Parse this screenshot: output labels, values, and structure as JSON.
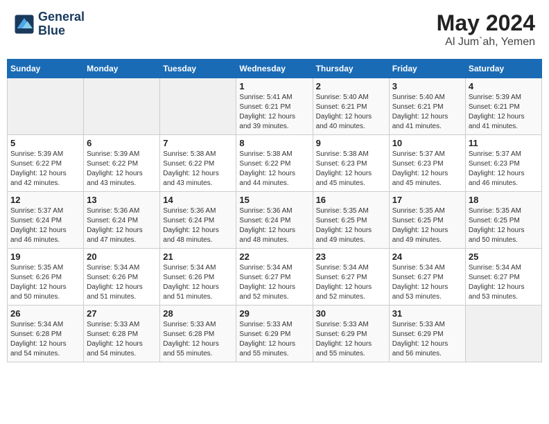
{
  "header": {
    "logo_line1": "General",
    "logo_line2": "Blue",
    "title": "May 2024",
    "subtitle": "Al Jum`ah, Yemen"
  },
  "weekdays": [
    "Sunday",
    "Monday",
    "Tuesday",
    "Wednesday",
    "Thursday",
    "Friday",
    "Saturday"
  ],
  "weeks": [
    [
      {
        "day": "",
        "info": ""
      },
      {
        "day": "",
        "info": ""
      },
      {
        "day": "",
        "info": ""
      },
      {
        "day": "1",
        "info": "Sunrise: 5:41 AM\nSunset: 6:21 PM\nDaylight: 12 hours\nand 39 minutes."
      },
      {
        "day": "2",
        "info": "Sunrise: 5:40 AM\nSunset: 6:21 PM\nDaylight: 12 hours\nand 40 minutes."
      },
      {
        "day": "3",
        "info": "Sunrise: 5:40 AM\nSunset: 6:21 PM\nDaylight: 12 hours\nand 41 minutes."
      },
      {
        "day": "4",
        "info": "Sunrise: 5:39 AM\nSunset: 6:21 PM\nDaylight: 12 hours\nand 41 minutes."
      }
    ],
    [
      {
        "day": "5",
        "info": "Sunrise: 5:39 AM\nSunset: 6:22 PM\nDaylight: 12 hours\nand 42 minutes."
      },
      {
        "day": "6",
        "info": "Sunrise: 5:39 AM\nSunset: 6:22 PM\nDaylight: 12 hours\nand 43 minutes."
      },
      {
        "day": "7",
        "info": "Sunrise: 5:38 AM\nSunset: 6:22 PM\nDaylight: 12 hours\nand 43 minutes."
      },
      {
        "day": "8",
        "info": "Sunrise: 5:38 AM\nSunset: 6:22 PM\nDaylight: 12 hours\nand 44 minutes."
      },
      {
        "day": "9",
        "info": "Sunrise: 5:38 AM\nSunset: 6:23 PM\nDaylight: 12 hours\nand 45 minutes."
      },
      {
        "day": "10",
        "info": "Sunrise: 5:37 AM\nSunset: 6:23 PM\nDaylight: 12 hours\nand 45 minutes."
      },
      {
        "day": "11",
        "info": "Sunrise: 5:37 AM\nSunset: 6:23 PM\nDaylight: 12 hours\nand 46 minutes."
      }
    ],
    [
      {
        "day": "12",
        "info": "Sunrise: 5:37 AM\nSunset: 6:24 PM\nDaylight: 12 hours\nand 46 minutes."
      },
      {
        "day": "13",
        "info": "Sunrise: 5:36 AM\nSunset: 6:24 PM\nDaylight: 12 hours\nand 47 minutes."
      },
      {
        "day": "14",
        "info": "Sunrise: 5:36 AM\nSunset: 6:24 PM\nDaylight: 12 hours\nand 48 minutes."
      },
      {
        "day": "15",
        "info": "Sunrise: 5:36 AM\nSunset: 6:24 PM\nDaylight: 12 hours\nand 48 minutes."
      },
      {
        "day": "16",
        "info": "Sunrise: 5:35 AM\nSunset: 6:25 PM\nDaylight: 12 hours\nand 49 minutes."
      },
      {
        "day": "17",
        "info": "Sunrise: 5:35 AM\nSunset: 6:25 PM\nDaylight: 12 hours\nand 49 minutes."
      },
      {
        "day": "18",
        "info": "Sunrise: 5:35 AM\nSunset: 6:25 PM\nDaylight: 12 hours\nand 50 minutes."
      }
    ],
    [
      {
        "day": "19",
        "info": "Sunrise: 5:35 AM\nSunset: 6:26 PM\nDaylight: 12 hours\nand 50 minutes."
      },
      {
        "day": "20",
        "info": "Sunrise: 5:34 AM\nSunset: 6:26 PM\nDaylight: 12 hours\nand 51 minutes."
      },
      {
        "day": "21",
        "info": "Sunrise: 5:34 AM\nSunset: 6:26 PM\nDaylight: 12 hours\nand 51 minutes."
      },
      {
        "day": "22",
        "info": "Sunrise: 5:34 AM\nSunset: 6:27 PM\nDaylight: 12 hours\nand 52 minutes."
      },
      {
        "day": "23",
        "info": "Sunrise: 5:34 AM\nSunset: 6:27 PM\nDaylight: 12 hours\nand 52 minutes."
      },
      {
        "day": "24",
        "info": "Sunrise: 5:34 AM\nSunset: 6:27 PM\nDaylight: 12 hours\nand 53 minutes."
      },
      {
        "day": "25",
        "info": "Sunrise: 5:34 AM\nSunset: 6:27 PM\nDaylight: 12 hours\nand 53 minutes."
      }
    ],
    [
      {
        "day": "26",
        "info": "Sunrise: 5:34 AM\nSunset: 6:28 PM\nDaylight: 12 hours\nand 54 minutes."
      },
      {
        "day": "27",
        "info": "Sunrise: 5:33 AM\nSunset: 6:28 PM\nDaylight: 12 hours\nand 54 minutes."
      },
      {
        "day": "28",
        "info": "Sunrise: 5:33 AM\nSunset: 6:28 PM\nDaylight: 12 hours\nand 55 minutes."
      },
      {
        "day": "29",
        "info": "Sunrise: 5:33 AM\nSunset: 6:29 PM\nDaylight: 12 hours\nand 55 minutes."
      },
      {
        "day": "30",
        "info": "Sunrise: 5:33 AM\nSunset: 6:29 PM\nDaylight: 12 hours\nand 55 minutes."
      },
      {
        "day": "31",
        "info": "Sunrise: 5:33 AM\nSunset: 6:29 PM\nDaylight: 12 hours\nand 56 minutes."
      },
      {
        "day": "",
        "info": ""
      }
    ]
  ]
}
